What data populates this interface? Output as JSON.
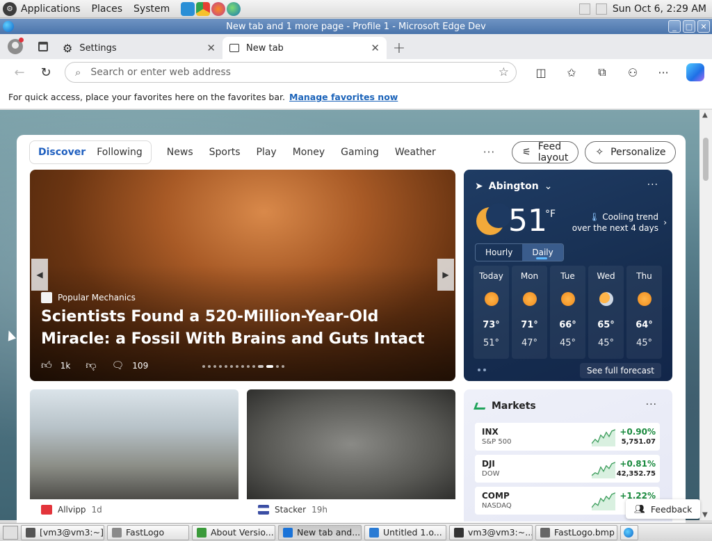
{
  "topbar": {
    "menus": [
      "Applications",
      "Places",
      "System"
    ],
    "clock": "Sun Oct  6,  2:29 AM"
  },
  "window": {
    "title": "New tab and 1 more page - Profile 1 - Microsoft Edge Dev",
    "controls": [
      "_",
      "□",
      "✕"
    ]
  },
  "tabs": [
    {
      "label": "Settings",
      "close": "✕"
    },
    {
      "label": "New tab",
      "close": "✕"
    }
  ],
  "new_tab_glyph": "+",
  "address": {
    "placeholder": "Search or enter web address"
  },
  "favorites_bar": {
    "hint": "For quick access, place your favorites here on the favorites bar.",
    "link": "Manage favorites now"
  },
  "feed": {
    "segments": [
      "Discover",
      "Following"
    ],
    "categories": [
      "News",
      "Sports",
      "Play",
      "Money",
      "Gaming",
      "Weather"
    ],
    "more": "···",
    "layout_button": "Feed layout",
    "personalize_button": "Personalize"
  },
  "hero": {
    "source": "Popular Mechanics",
    "headline": "Scientists Found a 520-Million-Year-Old Miracle: a Fossil With Brains and Guts Intact",
    "likes": "1k",
    "comments": "109"
  },
  "weather": {
    "location": "Abington",
    "temperature": "51",
    "unit": "°F",
    "trend": "Cooling trend over the next 4 days",
    "toggle": [
      "Hourly",
      "Daily"
    ],
    "days": [
      {
        "name": "Today",
        "high": "73°",
        "low": "51°"
      },
      {
        "name": "Mon",
        "high": "71°",
        "low": "47°"
      },
      {
        "name": "Tue",
        "high": "66°",
        "low": "45°"
      },
      {
        "name": "Wed",
        "high": "65°",
        "low": "45°"
      },
      {
        "name": "Thu",
        "high": "64°",
        "low": "45°"
      }
    ],
    "full_forecast": "See full forecast"
  },
  "cards": [
    {
      "source": "Allvipp",
      "age": "1d"
    },
    {
      "source": "Stacker",
      "age": "19h"
    }
  ],
  "markets": {
    "title": "Markets",
    "rows": [
      {
        "ticker": "INX",
        "name": "S&P 500",
        "change": "+0.90%",
        "price": "5,751.07"
      },
      {
        "ticker": "DJI",
        "name": "DOW",
        "change": "+0.81%",
        "price": "42,352.75"
      },
      {
        "ticker": "COMP",
        "name": "NASDAQ",
        "change": "+1.22%",
        "price": ""
      }
    ]
  },
  "feedback": "Feedback",
  "taskbar": [
    {
      "label": "[vm3@vm3:~]",
      "color": "#555555"
    },
    {
      "label": "FastLogo",
      "color": "#8a8a8a"
    },
    {
      "label": "About Versio...",
      "color": "#3a9a3a"
    },
    {
      "label": "New tab and...",
      "color": "#1a73d8"
    },
    {
      "label": "Untitled 1.o...",
      "color": "#2a7bd4"
    },
    {
      "label": "vm3@vm3:~...",
      "color": "#333333"
    },
    {
      "label": "FastLogo.bmp",
      "color": "#666666"
    }
  ]
}
